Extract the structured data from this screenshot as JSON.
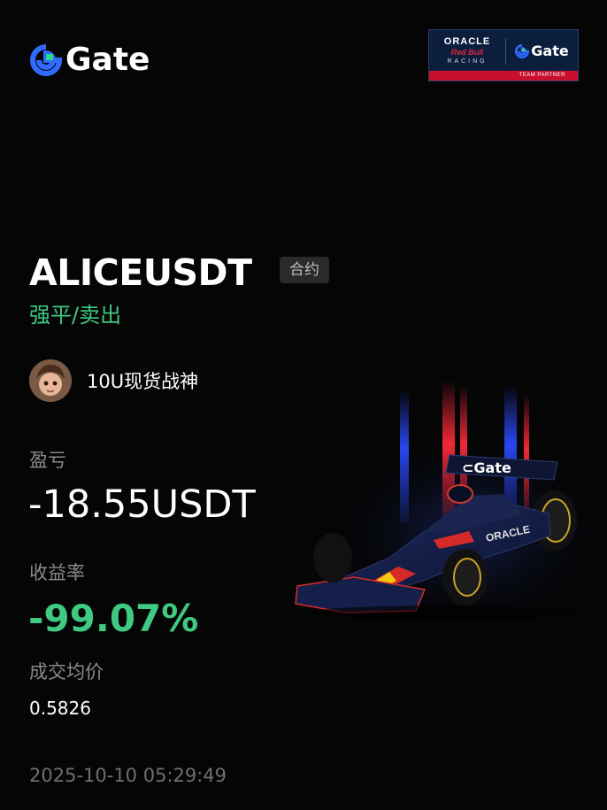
{
  "brand": {
    "name": "Gate",
    "accent_blue": "#2f6bff",
    "accent_green": "#29d68a"
  },
  "partner": {
    "oracle": "ORACLE",
    "redbull": "Red Bull",
    "racing": "RACING",
    "gate": "Gate",
    "team_partner": "TEAM PARTNER"
  },
  "trade": {
    "symbol": "ALICEUSDT",
    "tag": "合约",
    "direction": "强平/卖出"
  },
  "user": {
    "name": "10U现货战神"
  },
  "stats": {
    "pnl_label": "盈亏",
    "pnl_value": "-18.55USDT",
    "roi_label": "收益率",
    "roi_value": "-99.07%",
    "avg_price_label": "成交均价",
    "avg_price_value": "0.5826"
  },
  "timestamp": "2025-10-10 05:29:49",
  "colors": {
    "background": "#050505",
    "positive_green": "#3fc981",
    "muted_text": "#8a8a8a",
    "tag_bg": "#2a2a2a",
    "partner_bg": "#0c1e3e",
    "partner_red": "#c8102e"
  }
}
